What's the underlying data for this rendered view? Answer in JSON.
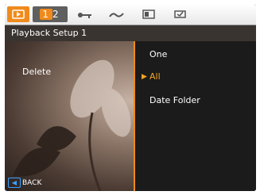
{
  "topbar": {
    "tabs": [
      {
        "icon": "playback-icon"
      },
      {
        "label_1": "1",
        "label_2": "2"
      },
      {
        "icon": "key-icon"
      },
      {
        "icon": "wave-icon"
      },
      {
        "icon": "card-icon"
      },
      {
        "icon": "battery-icon"
      }
    ]
  },
  "title": "Playback Setup 1",
  "menu": {
    "item_label": "Delete",
    "options": [
      "One",
      "All",
      "Date Folder"
    ],
    "selected": "All",
    "selected_pointer": "▶"
  },
  "footer": {
    "back_label": "BACK",
    "back_icon": "◀"
  },
  "colors": {
    "accent": "#f08a1c",
    "selected_text": "#f5a623",
    "back_icon": "#3aa0ff"
  }
}
